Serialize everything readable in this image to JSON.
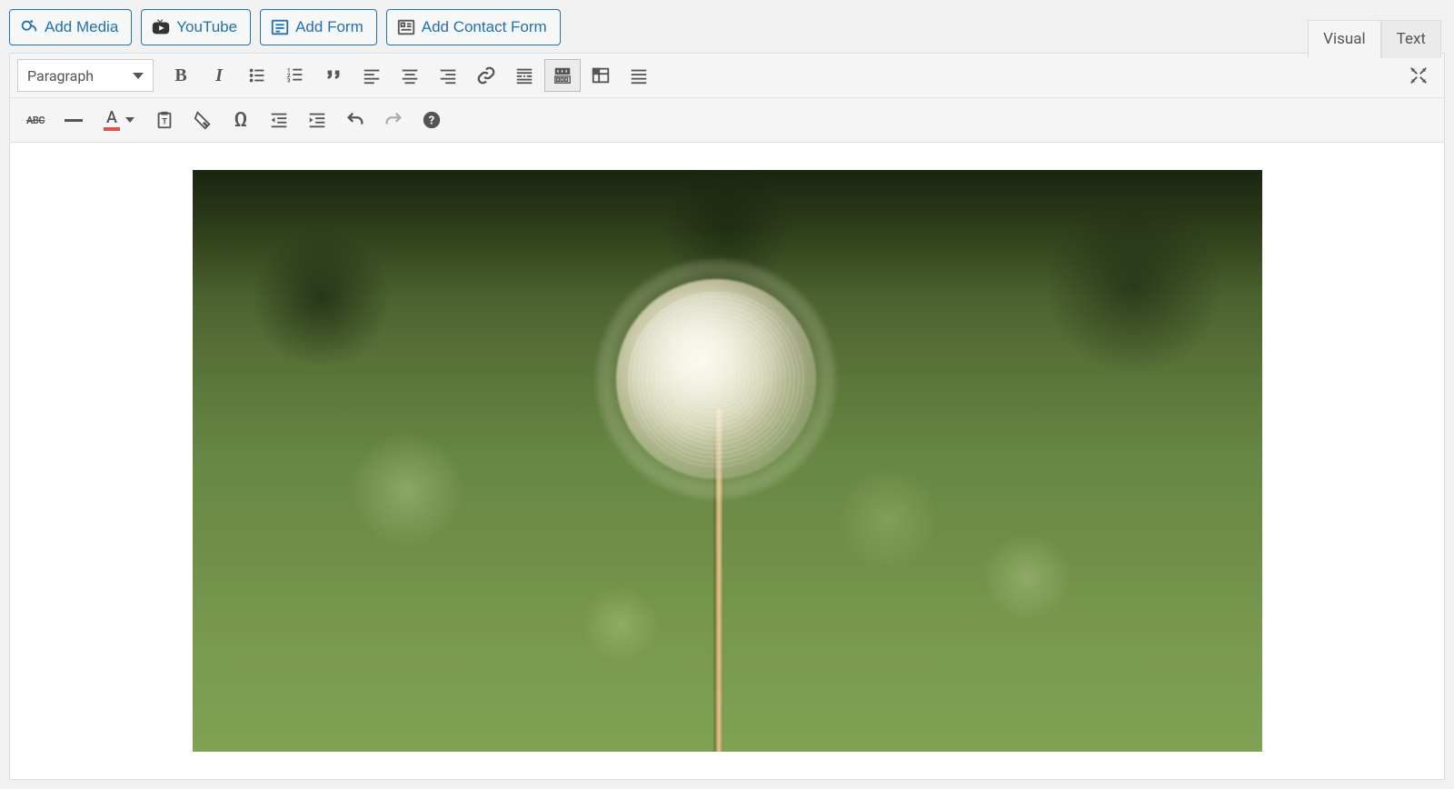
{
  "media_buttons": {
    "add_media": "Add Media",
    "youtube": "YouTube",
    "add_form": "Add Form",
    "add_contact_form": "Add Contact Form"
  },
  "tabs": {
    "visual": "Visual",
    "text": "Text",
    "active": "visual"
  },
  "toolbar": {
    "format_select": "Paragraph"
  },
  "strikethrough_label": "ABC",
  "textcolor_letter": "A"
}
